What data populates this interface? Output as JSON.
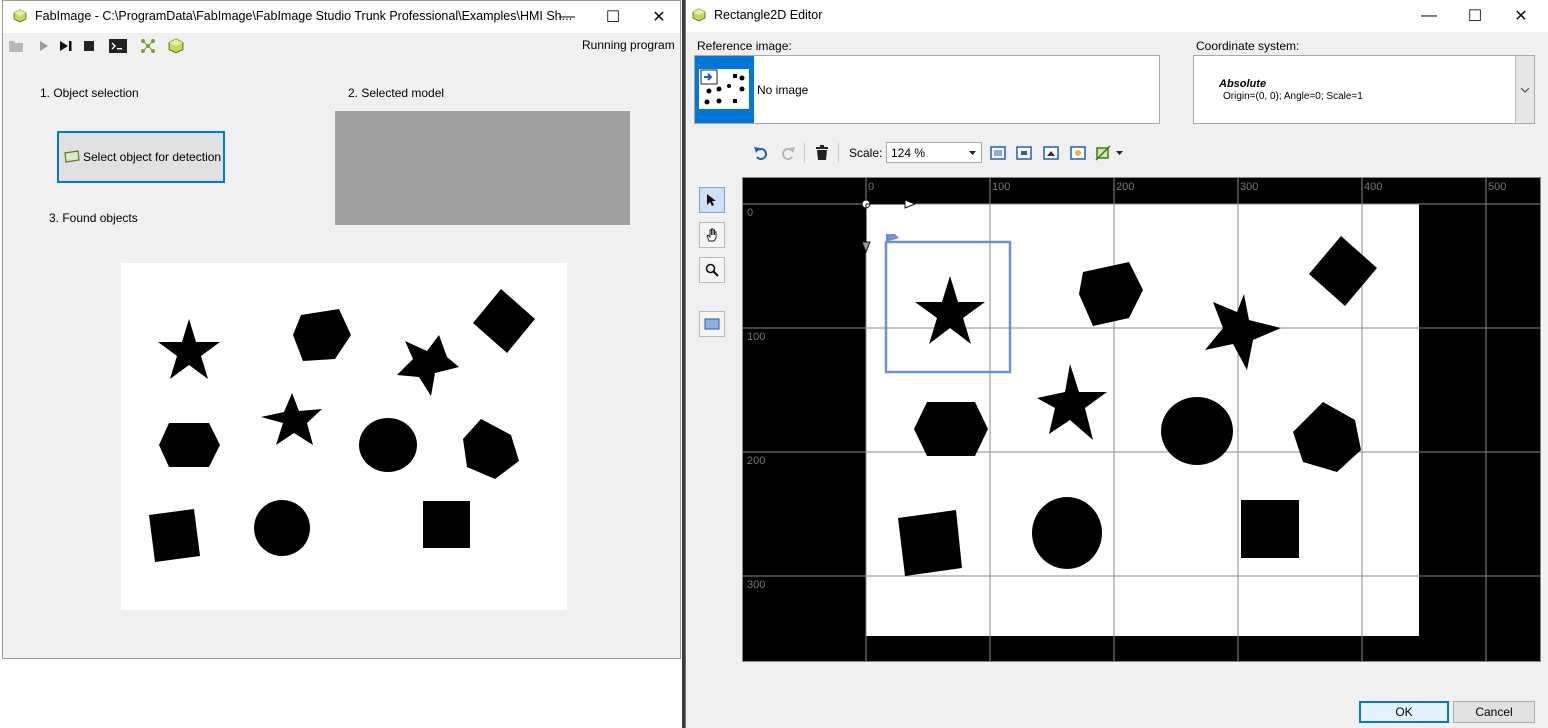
{
  "left_window": {
    "title": "FabImage - C:\\ProgramData\\FabImage\\FabImage Studio Trunk Professional\\Examples\\HMI Sh...",
    "status": "Running program",
    "section1_label": "1. Object selection",
    "section2_label": "2. Selected model",
    "section3_label": "3. Found objects",
    "select_button_label": "Select object for detection",
    "toolbar_icons": [
      "folder-icon",
      "play-icon",
      "step-icon",
      "stop-icon",
      "console-icon",
      "network-icon",
      "cube-icon"
    ]
  },
  "right_window": {
    "title": "Rectangle2D Editor",
    "reference_image_label": "Reference image:",
    "reference_image_value": "No image",
    "coordinate_system_label": "Coordinate system:",
    "coord_mode": "Absolute",
    "coord_details": "Origin=(0, 0); Angle=0; Scale=1",
    "scale_label": "Scale:",
    "scale_value": "124 %",
    "ok_label": "OK",
    "cancel_label": "Cancel",
    "ruler_x": [
      "0",
      "100",
      "200",
      "300",
      "400",
      "500"
    ],
    "ruler_y": [
      "0",
      "100",
      "200",
      "300"
    ],
    "colors": {
      "accent": "#0078d7",
      "selection": "#6f8fd6"
    }
  }
}
